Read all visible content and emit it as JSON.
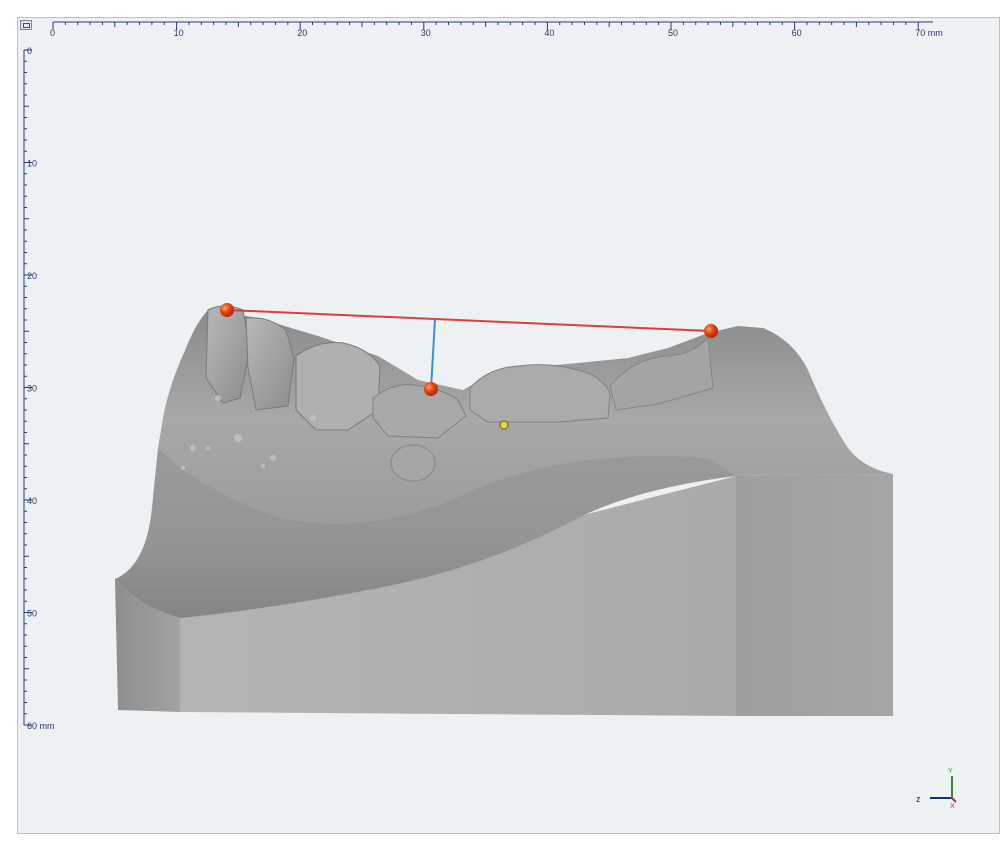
{
  "viewport": {
    "background": "#eef1f3",
    "model_color": "#9c9c9c"
  },
  "ruler_top": {
    "ticks": [
      "0",
      "10",
      "20",
      "30",
      "40",
      "50",
      "60",
      "70 mm"
    ]
  },
  "ruler_left": {
    "ticks": [
      "0",
      "10",
      "20",
      "30",
      "40",
      "50",
      "60 mm"
    ]
  },
  "measurement": {
    "point_color": "#e8420e",
    "line_color": "#e03c3c",
    "perpendicular_color": "#3a8fd8",
    "marker_color": "#e8d24a"
  },
  "axis_triad": {
    "z_label": "z",
    "y_label": "Y",
    "x_label": "X",
    "z_color": "#1a2a8a",
    "y_color": "#2e8b2e",
    "x_color": "#c03030"
  },
  "icons": {
    "view_toggle": "view-toggle-icon"
  }
}
